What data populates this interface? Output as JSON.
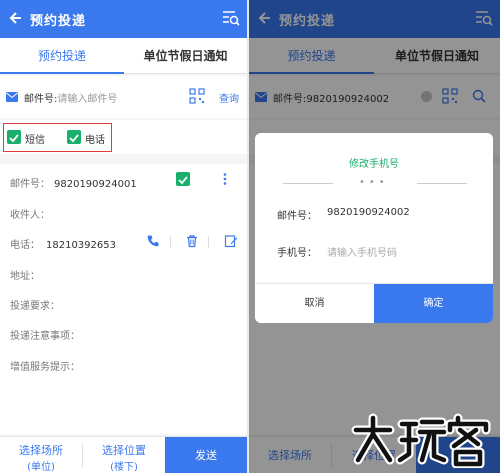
{
  "app": {
    "title": "预约投递",
    "accent": "#3a78ee",
    "checkbox_color": "#18b06a",
    "highlight_border": "#e23c3c"
  },
  "tabs": [
    {
      "label": "预约投递",
      "active": true
    },
    {
      "label": "单位节假日通知",
      "active": false
    }
  ],
  "left": {
    "scan": {
      "label": "邮件号:",
      "placeholder": "请输入邮件号",
      "query": "查询"
    },
    "notify": {
      "sms": "短信",
      "phone": "电话"
    },
    "form": {
      "mail_no_label": "邮件号：",
      "mail_no_value": "9820190924001",
      "recipient_label": "收件人：",
      "phone_label": "电话：",
      "phone_value": "18210392653",
      "address_label": "地址：",
      "delivery_req_label": "投递要求：",
      "delivery_note_label": "投递注意事项：",
      "value_added_label": "增值服务提示："
    },
    "bottom": {
      "place_line1": "选择场所",
      "place_line2": "(单位)",
      "position_line1": "选择位置",
      "position_line2": "(楼下)",
      "send": "发送"
    }
  },
  "right": {
    "scan": {
      "label": "邮件号:",
      "value": "9820190924002"
    },
    "bottom": {
      "place": "选择场所",
      "position": "选择位置"
    },
    "dialog": {
      "title": "修改手机号",
      "mail_no_label": "邮件号：",
      "mail_no_value": "9820190924002",
      "phone_label": "手机号：",
      "phone_placeholder": "请输入手机号码",
      "cancel": "取消",
      "confirm": "确定"
    }
  },
  "watermark": "大玩客"
}
